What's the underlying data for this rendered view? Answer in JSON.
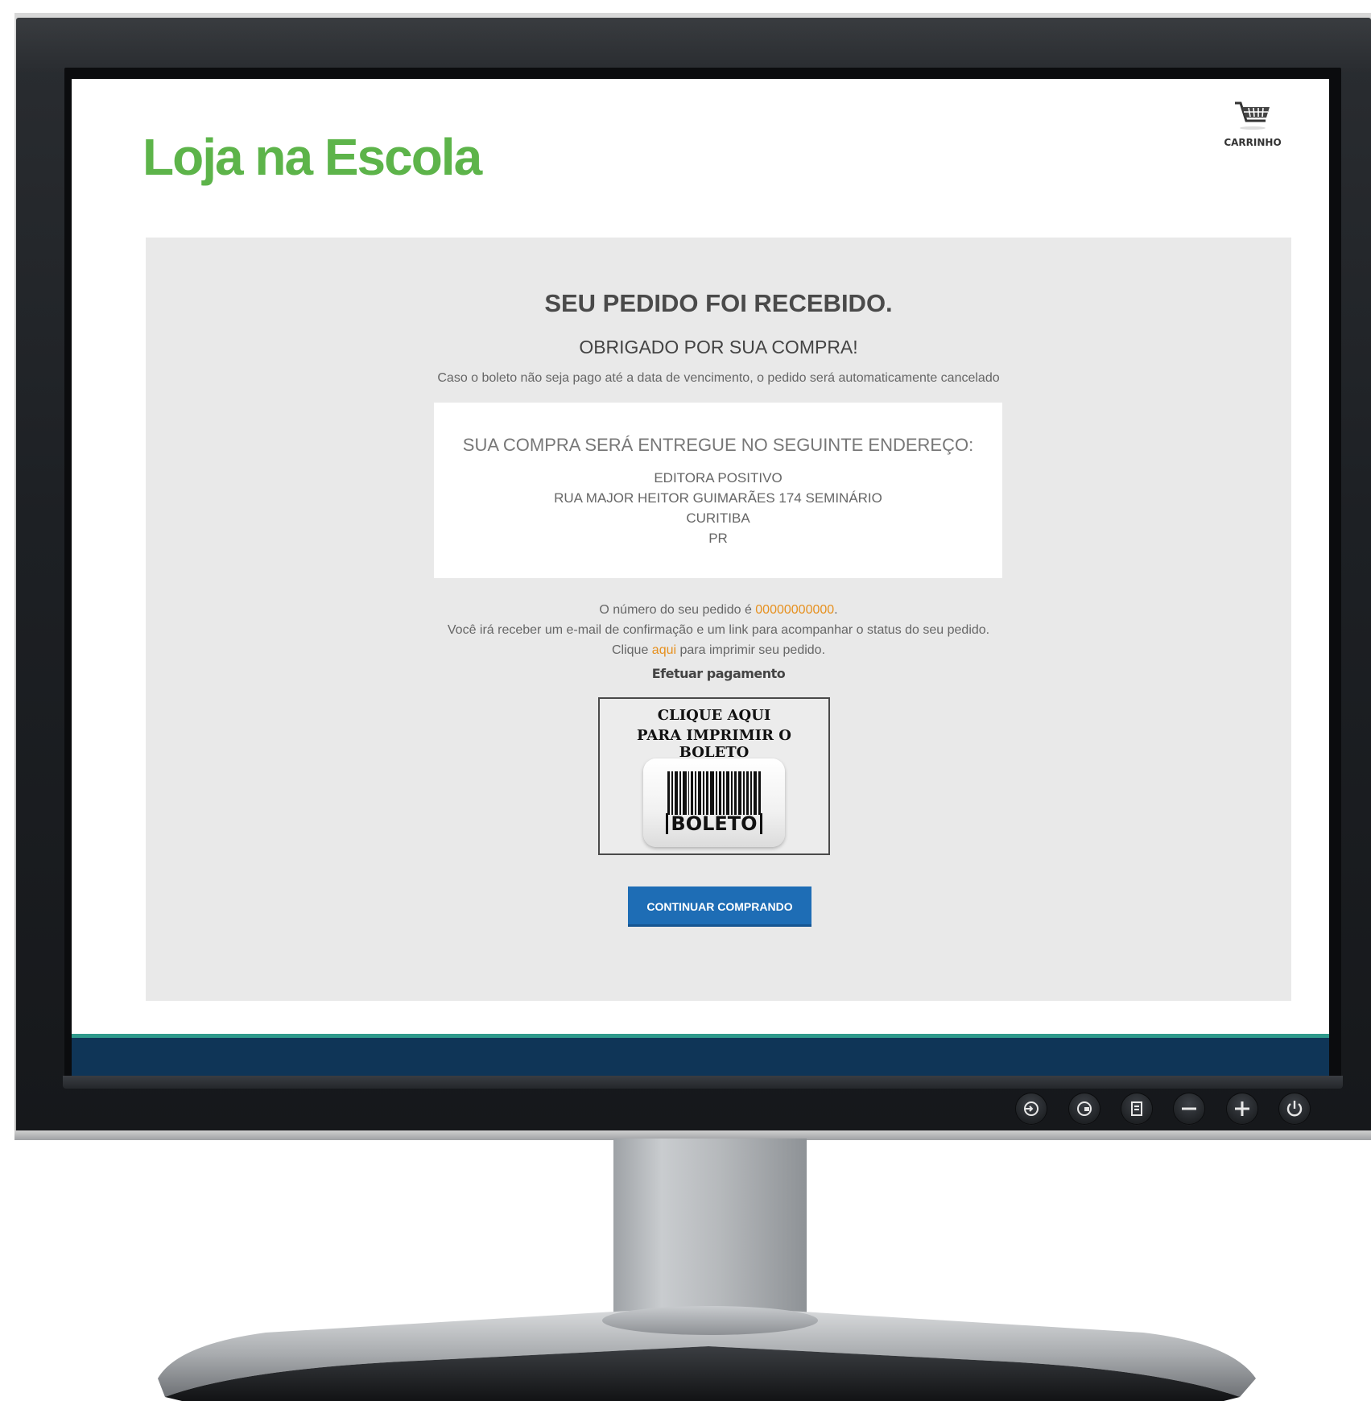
{
  "site": {
    "logo": "Loja na Escola",
    "cart_label": "CARRINHO"
  },
  "confirmation": {
    "title": "SEU PEDIDO FOI RECEBIDO.",
    "subtitle": "OBRIGADO POR SUA COMPRA!",
    "notice": "Caso o boleto não seja pago até a data de vencimento, o pedido será automaticamente cancelado"
  },
  "address": {
    "heading": "SUA COMPRA SERÁ ENTREGUE NO SEGUINTE ENDEREÇO:",
    "lines": [
      "EDITORA POSITIVO",
      "RUA MAJOR HEITOR GUIMARÃES 174 SEMINÁRIO",
      "CURITIBA",
      "PR"
    ]
  },
  "order": {
    "number_prefix": "O número do seu pedido é ",
    "number": "00000000000",
    "number_suffix": ".",
    "email_notice": "Você irá receber um e-mail de confirmação e um link para acompanhar o status do seu pedido.",
    "print_prefix": "Clique ",
    "print_link": "aqui",
    "print_suffix": " para imprimir seu pedido."
  },
  "payment": {
    "label": "Efetuar pagamento",
    "boleto_line1": "CLIQUE AQUI",
    "boleto_line2": "PARA IMPRIMIR O BOLETO",
    "boleto_word": "BOLETO"
  },
  "actions": {
    "continue_label": "CONTINUAR COMPRANDO"
  },
  "monitor_buttons": [
    "input-icon",
    "menu-icon",
    "select-icon",
    "minus-icon",
    "plus-icon",
    "power-icon"
  ],
  "colors": {
    "brand_green": "#5db44a",
    "link_orange": "#e6901e",
    "button_blue": "#1e6db5",
    "footer_navy": "#0f3557"
  }
}
